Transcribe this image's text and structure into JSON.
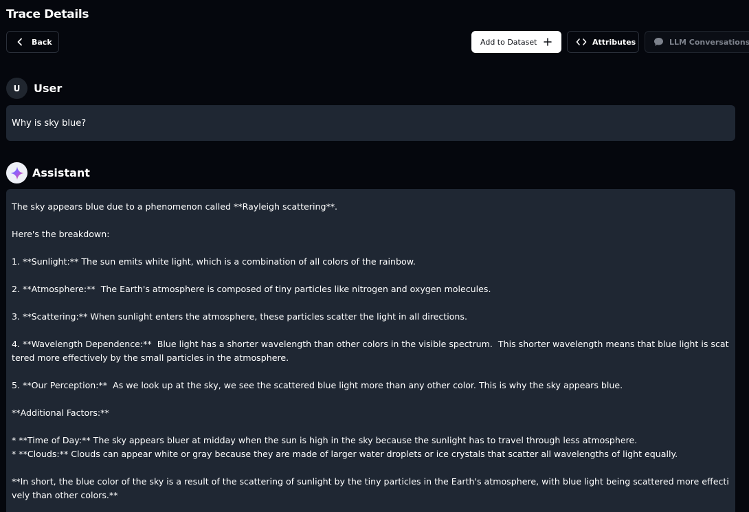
{
  "page": {
    "title": "Trace Details"
  },
  "toolbar": {
    "back_label": "Back",
    "add_to_dataset_label": "Add to Dataset",
    "attributes_label": "Attributes",
    "llm_conversations_label": "LLM Conversations"
  },
  "conversation": {
    "user": {
      "avatar_letter": "U",
      "role_label": "User",
      "message": "Why is sky blue?"
    },
    "assistant": {
      "role_label": "Assistant",
      "message": "The sky appears blue due to a phenomenon called **Rayleigh scattering**.\n\nHere's the breakdown:\n\n1. **Sunlight:** The sun emits white light, which is a combination of all colors of the rainbow.\n\n2. **Atmosphere:**  The Earth's atmosphere is composed of tiny particles like nitrogen and oxygen molecules.\n\n3. **Scattering:** When sunlight enters the atmosphere, these particles scatter the light in all directions.\n\n4. **Wavelength Dependence:**  Blue light has a shorter wavelength than other colors in the visible spectrum.  This shorter wavelength means that blue light is scattered more effectively by the small particles in the atmosphere.\n\n5. **Our Perception:**  As we look up at the sky, we see the scattered blue light more than any other color. This is why the sky appears blue.\n\n**Additional Factors:**\n\n* **Time of Day:** The sky appears bluer at midday when the sun is high in the sky because the sunlight has to travel through less atmosphere.\n* **Clouds:** Clouds can appear white or gray because they are made of larger water droplets or ice crystals that scatter all wavelengths of light equally.\n\n**In short, the blue color of the sky is a result of the scattering of sunlight by the tiny particles in the Earth's atmosphere, with blue light being scattered more effectively than other colors.**"
    }
  },
  "icons": {
    "back": "chevron-left-icon",
    "add": "plus-icon",
    "attributes": "code-brackets-icon",
    "llm": "chat-bubble-icon",
    "assistant_avatar": "sparkle-icon"
  },
  "colors": {
    "background": "#05070d",
    "message_bg": "#1f2733",
    "primary_button_bg": "#ffffff",
    "muted_text": "#7d828c"
  }
}
